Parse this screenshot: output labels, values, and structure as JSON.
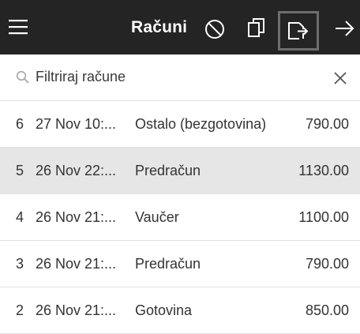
{
  "toolbar": {
    "title": "Računi",
    "icons": [
      "menu-icon",
      "cancel-icon",
      "copy-icon",
      "export-icon",
      "arrow-right-icon"
    ]
  },
  "filter": {
    "placeholder": "Filtriraj račune",
    "icons": [
      "search-icon",
      "clear-icon"
    ]
  },
  "invoices": [
    {
      "num": "6",
      "date": "27 Nov 10:...",
      "type": "Ostalo (bezgotovina)",
      "total": "790.00",
      "selected": false
    },
    {
      "num": "5",
      "date": "26 Nov 22:...",
      "type": "Predračun",
      "total": "1130.00",
      "selected": true
    },
    {
      "num": "4",
      "date": "26 Nov 21:...",
      "type": "Vaučer",
      "total": "1100.00",
      "selected": false
    },
    {
      "num": "3",
      "date": "26 Nov 21:...",
      "type": "Predračun",
      "total": "790.00",
      "selected": false
    },
    {
      "num": "2",
      "date": "26 Nov 21:...",
      "type": "Gotovina",
      "total": "850.00",
      "selected": false
    }
  ],
  "colors": {
    "toolbar_bg": "#242424",
    "selected_row_bg": "#e6e6e6"
  }
}
